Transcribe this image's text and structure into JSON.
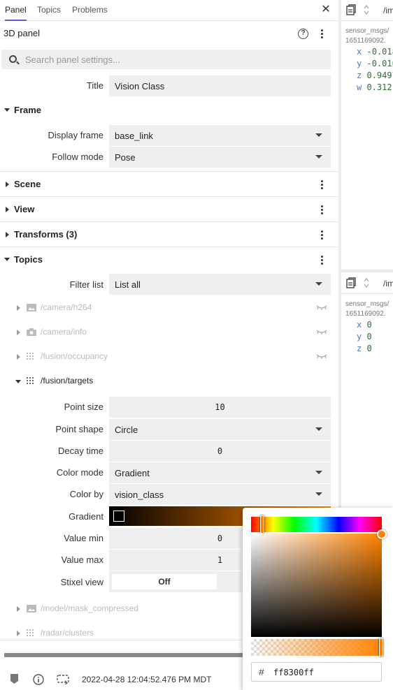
{
  "tabs": [
    "Panel",
    "Topics",
    "Problems"
  ],
  "panel_title": "3D panel",
  "search": {
    "placeholder": "Search panel settings..."
  },
  "title_field": {
    "label": "Title",
    "value": "Vision Class"
  },
  "frame": {
    "section": "Frame",
    "display_frame": {
      "label": "Display frame",
      "value": "base_link"
    },
    "follow_mode": {
      "label": "Follow mode",
      "value": "Pose"
    }
  },
  "sections": {
    "scene": "Scene",
    "view": "View",
    "transforms": "Transforms (3)",
    "topics": "Topics"
  },
  "filter_list": {
    "label": "Filter list",
    "value": "List all"
  },
  "topic_list": [
    {
      "name": "/camera/h264",
      "icon": "image-icon"
    },
    {
      "name": "/camera/info",
      "icon": "camera-icon"
    },
    {
      "name": "/fusion/occupancy",
      "icon": "grid-icon"
    }
  ],
  "fusion_targets": {
    "name": "/fusion/targets",
    "point_size": {
      "label": "Point size",
      "value": "10"
    },
    "point_shape": {
      "label": "Point shape",
      "value": "Circle"
    },
    "decay_time": {
      "label": "Decay time",
      "value": "0"
    },
    "color_mode": {
      "label": "Color mode",
      "value": "Gradient"
    },
    "color_by": {
      "label": "Color by",
      "value": "vision_class"
    },
    "gradient": {
      "label": "Gradient"
    },
    "value_min": {
      "label": "Value min",
      "value": "0"
    },
    "value_max": {
      "label": "Value max",
      "value": "1"
    },
    "stixel_view": {
      "label": "Stixel view",
      "value": "Off"
    }
  },
  "topic_list_bottom": [
    {
      "name": "/model/mask_compressed",
      "icon": "image-icon"
    },
    {
      "name": "/radar/clusters",
      "icon": "grid-icon"
    }
  ],
  "footer": {
    "timestamp": "2022-04-28 12:04:52.476 PM MDT"
  },
  "color_picker": {
    "hex_symbol": "#",
    "hex_value": "ff8300ff"
  },
  "right_panel_1": {
    "topic": "/im",
    "type": "sensor_msgs/",
    "stamp": "1651169092.",
    "rows": [
      {
        "key": "x",
        "value": "-0.018"
      },
      {
        "key": "y",
        "value": "-0.010"
      },
      {
        "key": "z",
        "value": "0.9497"
      },
      {
        "key": "w",
        "value": "0.312"
      }
    ]
  },
  "right_panel_2": {
    "topic": "/im",
    "type": "sensor_msgs/",
    "stamp": "1651169092.",
    "rows": [
      {
        "key": "x",
        "value": "0"
      },
      {
        "key": "y",
        "value": "0"
      },
      {
        "key": "z",
        "value": "0"
      }
    ]
  },
  "colors": {
    "accent": "#6b53d6",
    "gradient_end": "#ff8300"
  }
}
